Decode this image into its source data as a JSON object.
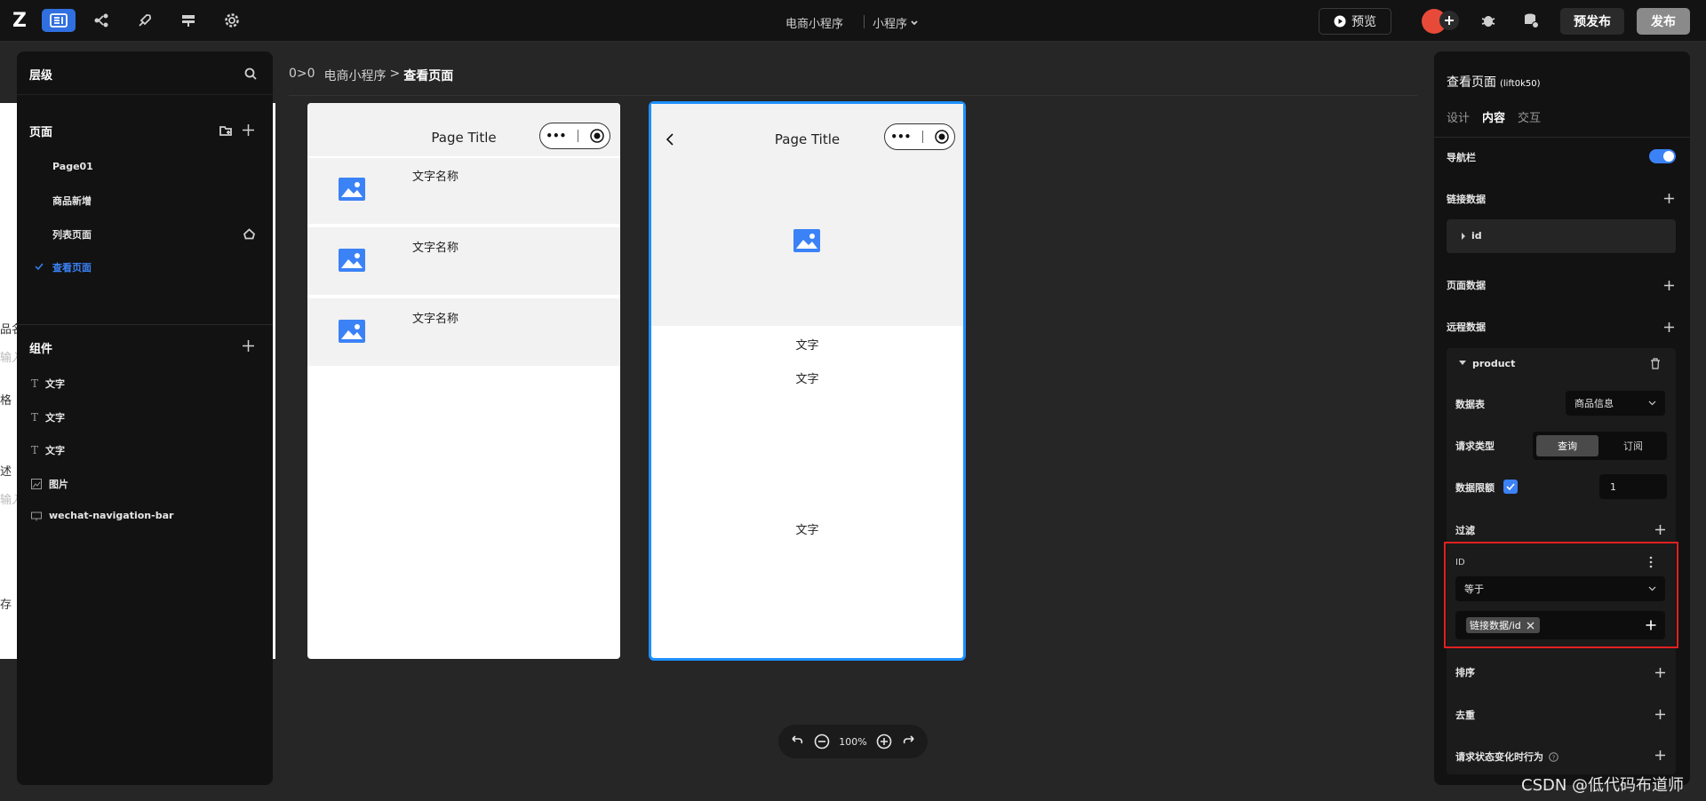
{
  "topbar": {
    "logo": "Z",
    "app_name": "电商小程序",
    "platform": "小程序",
    "preview_label": "预览",
    "prepublish_label": "预发布",
    "publish_label": "发布",
    "icons": [
      "layout-icon",
      "flow-icon",
      "rocket-icon",
      "database-table-icon",
      "gear-icon"
    ]
  },
  "left_panel": {
    "title": "层级",
    "pages_title": "页面",
    "pages": [
      "Page01",
      "商品新增",
      "列表页面",
      "查看页面"
    ],
    "active_page": "查看页面",
    "components_title": "组件",
    "components": [
      {
        "icon": "text-icon",
        "label": "文字"
      },
      {
        "icon": "text-icon",
        "label": "文字"
      },
      {
        "icon": "text-icon",
        "label": "文字"
      },
      {
        "icon": "image-icon",
        "label": "图片"
      },
      {
        "icon": "navbar-icon",
        "label": "wechat-navigation-bar"
      }
    ],
    "edge_fragments": [
      "品名",
      "输入",
      "格",
      "述",
      "输入",
      "存"
    ]
  },
  "breadcrumb": {
    "prefix": "0>0",
    "app": "电商小程序",
    "sep": ">",
    "page": "查看页面"
  },
  "phone1": {
    "title": "Page Title",
    "items": [
      "文字名称",
      "文字名称",
      "文字名称"
    ]
  },
  "phone2": {
    "title": "Page Title",
    "texts": [
      "文字",
      "文字",
      "文字"
    ]
  },
  "zoom": {
    "level": "100%"
  },
  "right_panel": {
    "title": "查看页面",
    "title_id": "(lift0k50)",
    "tabs": [
      "设计",
      "内容",
      "交互"
    ],
    "active_tab": "内容",
    "navbar_label": "导航栏",
    "link_data_label": "链接数据",
    "link_data_item": "id",
    "page_data_label": "页面数据",
    "remote_data_label": "远程数据",
    "remote_item": "product",
    "table_label": "数据表",
    "table_value": "商品信息",
    "request_type_label": "请求类型",
    "request_query": "查询",
    "request_subscribe": "订阅",
    "limit_label": "数据限额",
    "limit_value": "1",
    "filter_label": "过滤",
    "filter_field": "ID",
    "filter_op": "等于",
    "filter_tag": "链接数据/id",
    "sort_label": "排序",
    "dedupe_label": "去重",
    "state_change_label": "请求状态变化时行为"
  },
  "watermark": "CSDN @低代码布道师",
  "colors": {
    "accent": "#3b82f6",
    "highlight_border": "#e02020",
    "selection": "#1e90ff"
  }
}
